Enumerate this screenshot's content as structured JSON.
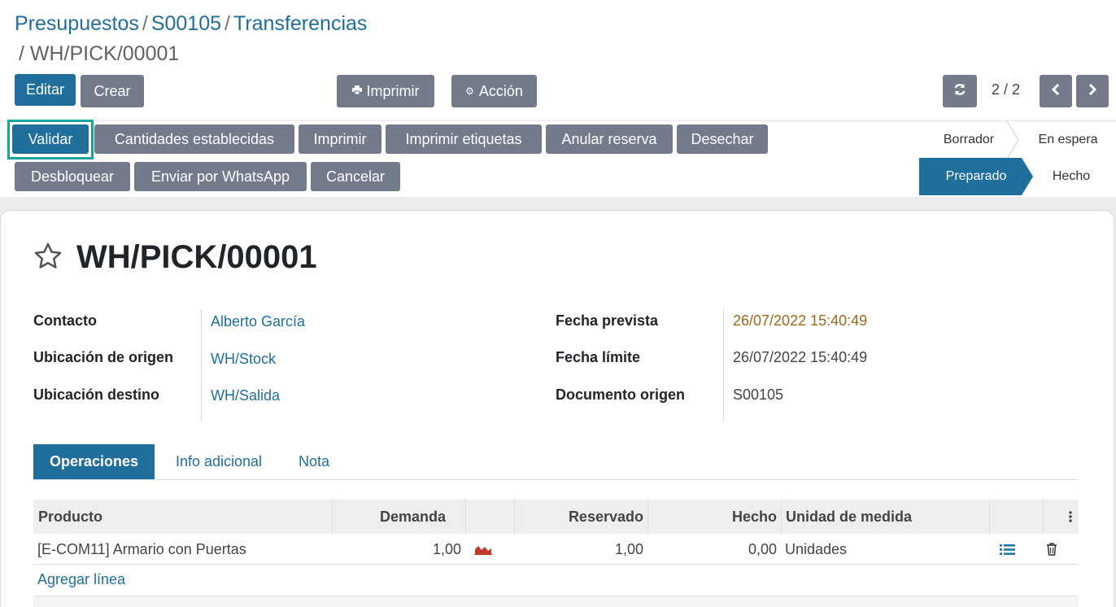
{
  "breadcrumb": {
    "items": [
      "Presupuestos",
      "S00105",
      "Transferencias"
    ],
    "separator": "/",
    "current": "/ WH/PICK/00001"
  },
  "toolbar": {
    "edit": "Editar",
    "create": "Crear",
    "print": "Imprimir",
    "action": "Acción",
    "pager": "2 / 2"
  },
  "header_buttons": {
    "validate": "Validar",
    "set_quantities": "Cantidades establecidas",
    "print": "Imprimir",
    "print_labels": "Imprimir etiquetas",
    "unreserve": "Anular reserva",
    "scrap": "Desechar",
    "unlock": "Desbloquear",
    "whatsapp": "Enviar por WhatsApp",
    "cancel": "Cancelar"
  },
  "status": {
    "draft": "Borrador",
    "waiting": "En espera",
    "ready": "Preparado",
    "done": "Hecho"
  },
  "record": {
    "title": "WH/PICK/00001",
    "fields_left": [
      {
        "label": "Contacto",
        "value": "Alberto García"
      },
      {
        "label": "Ubicación de origen",
        "value": "WH/Stock"
      },
      {
        "label": "Ubicación destino",
        "value": "WH/Salida"
      }
    ],
    "fields_right": [
      {
        "label": "Fecha prevista",
        "value": "26/07/2022 15:40:49"
      },
      {
        "label": "Fecha límite",
        "value": "26/07/2022 15:40:49"
      },
      {
        "label": "Documento origen",
        "value": "S00105"
      }
    ]
  },
  "tabs": [
    "Operaciones",
    "Info adicional",
    "Nota"
  ],
  "table": {
    "headers": [
      "Producto",
      "Demanda",
      "Reservado",
      "Hecho",
      "Unidad de medida"
    ],
    "rows": [
      {
        "product": "[E-COM11] Armario con Puertas",
        "demand": "1,00",
        "reserved": "1,00",
        "done": "0,00",
        "uom": "Unidades"
      }
    ],
    "add_line": "Agregar línea"
  },
  "colors": {
    "primary": "#1f6e9c",
    "secondary": "#737a8c",
    "highlight": "#1aa39a",
    "forecast_icon": "#c0392b"
  }
}
